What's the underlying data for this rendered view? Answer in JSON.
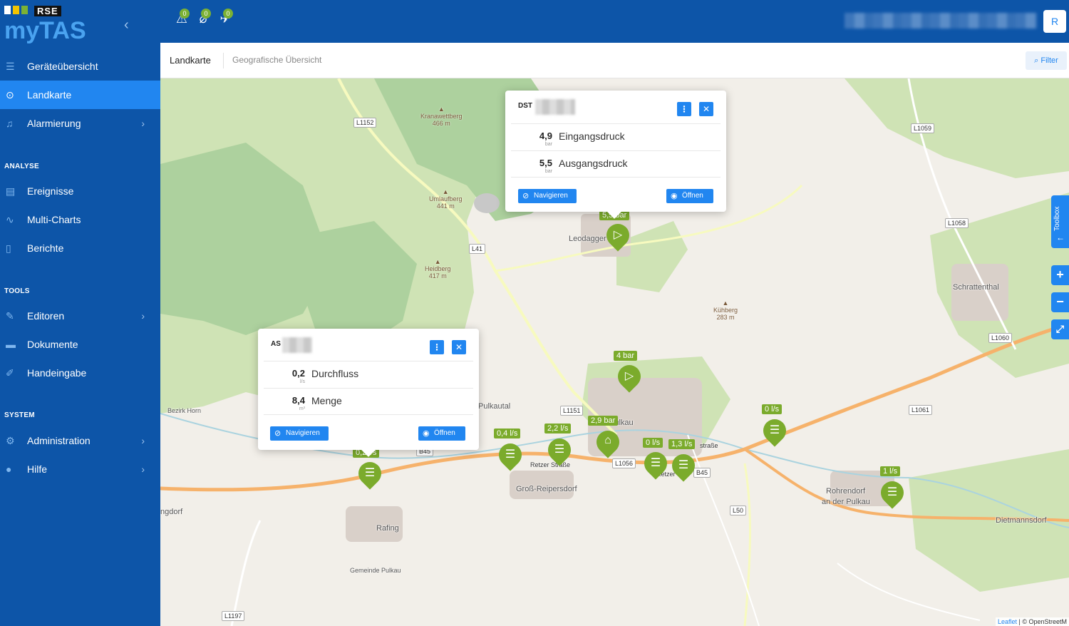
{
  "app": {
    "logo_brand": "RSE",
    "logo_name": "myTAS",
    "user_initial": "R"
  },
  "topbar": {
    "alerts": [
      {
        "icon": "warning-icon",
        "count": "0"
      },
      {
        "icon": "no-connection-icon",
        "count": "0"
      },
      {
        "icon": "no-signal-icon",
        "count": "0"
      }
    ]
  },
  "sidebar": {
    "items": [
      {
        "label": "Geräteübersicht",
        "icon": "list-icon"
      },
      {
        "label": "Landkarte",
        "icon": "map-pin-icon"
      },
      {
        "label": "Alarmierung",
        "icon": "bell-icon"
      }
    ],
    "section_analyse": "ANALYSE",
    "analyse": [
      {
        "label": "Ereignisse",
        "icon": "events-icon"
      },
      {
        "label": "Multi-Charts",
        "icon": "chart-line-icon"
      },
      {
        "label": "Berichte",
        "icon": "report-icon"
      }
    ],
    "section_tools": "TOOLS",
    "tools": [
      {
        "label": "Editoren",
        "icon": "edit-icon"
      },
      {
        "label": "Dokumente",
        "icon": "folder-icon"
      },
      {
        "label": "Handeingabe",
        "icon": "pencil-icon"
      }
    ],
    "section_system": "SYSTEM",
    "system": [
      {
        "label": "Administration",
        "icon": "gears-icon"
      },
      {
        "label": "Hilfe",
        "icon": "info-icon"
      }
    ]
  },
  "tabs": {
    "active": "Landkarte",
    "secondary": "Geografische Übersicht",
    "filter": "Filter"
  },
  "map": {
    "places": [
      "Leodagger",
      "Schrattenthal",
      "Pulkau",
      "Groß-Reipersdorf",
      "Rafing",
      "Rohrendorf",
      "an der Pulkau",
      "Dietmannsdorf",
      "Pulkautal",
      "Gemeinde Pulkau",
      "ngdorf",
      "Bezirk Horn"
    ],
    "peaks": [
      {
        "name": "Kranawettberg",
        "elev": "466 m"
      },
      {
        "name": "Umlaufberg",
        "elev": "441 m"
      },
      {
        "name": "Heidberg",
        "elev": "417 m"
      },
      {
        "name": "Kühberg",
        "elev": "283 m"
      }
    ],
    "roads": [
      "L1152",
      "L41",
      "L1059",
      "L1058",
      "L1060",
      "L1061",
      "L1151",
      "L1056",
      "B45",
      "L50",
      "L1197",
      "B45",
      "Retzer Straße",
      "Retzer Str.",
      "straße"
    ],
    "markers": [
      {
        "label": "5,5 bar",
        "glyph": "▷"
      },
      {
        "label": "4 bar",
        "glyph": "▷"
      },
      {
        "label": "2,9 bar",
        "glyph": "⌂"
      },
      {
        "label": "2,2 l/s",
        "glyph": "☰"
      },
      {
        "label": "0,4 l/s",
        "glyph": "☰"
      },
      {
        "label": "0,2 l/s",
        "glyph": "☰"
      },
      {
        "label": "0 l/s",
        "glyph": "☰"
      },
      {
        "label": "1,3 l/s",
        "glyph": "☰"
      },
      {
        "label": "0 l/s",
        "glyph": "☰"
      },
      {
        "label": "1 l/s",
        "glyph": "☰"
      }
    ],
    "toolbox": "Toolbox",
    "zoom_in": "+",
    "zoom_out": "−",
    "fullscreen": "⤢",
    "attribution_leaflet": "Leaflet",
    "attribution_osm": "© OpenStreetM"
  },
  "popup_dst": {
    "title": "DST",
    "rows": [
      {
        "value": "4,9",
        "unit": "bar",
        "label": "Eingangsdruck"
      },
      {
        "value": "5,5",
        "unit": "bar",
        "label": "Ausgangsdruck"
      }
    ],
    "navigate": "Navigieren",
    "open": "Öffnen"
  },
  "popup_as": {
    "title": "AS",
    "rows": [
      {
        "value": "0,2",
        "unit": "l/s",
        "label": "Durchfluss"
      },
      {
        "value": "8,4",
        "unit": "m³",
        "label": "Menge"
      }
    ],
    "navigate": "Navigieren",
    "open": "Öffnen"
  }
}
